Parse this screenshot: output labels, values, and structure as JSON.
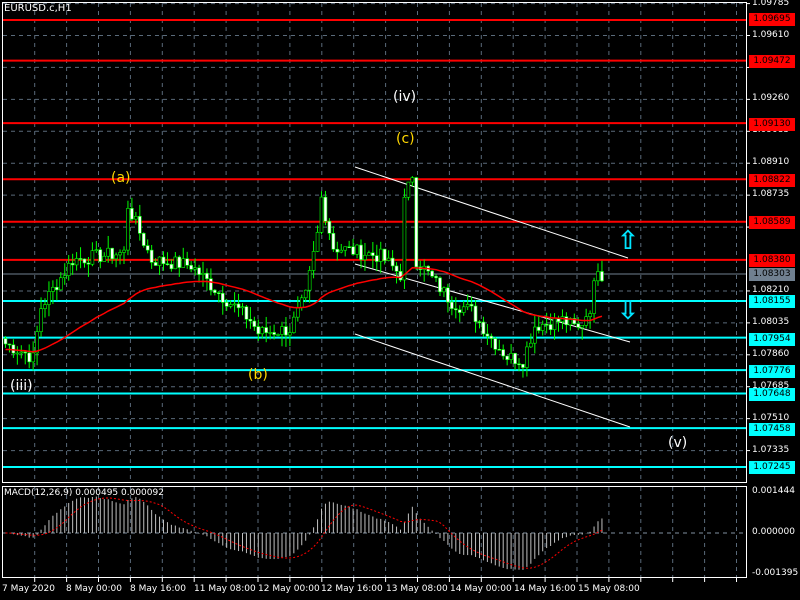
{
  "header": {
    "symbol_title": "EURUSD.c,H1"
  },
  "colors": {
    "resistance": "#ff0000",
    "support": "#00ffff",
    "bull": "#00ff00",
    "current": "#708090",
    "grid": "#6b7b8c",
    "ma": "#ff0000"
  },
  "price_axis": {
    "ticks": [
      "1.09785",
      "1.09610",
      "1.09435",
      "1.09260",
      "1.09085",
      "1.08910",
      "1.08735",
      "1.08560",
      "1.08210",
      "1.08035",
      "1.07860",
      "1.07685",
      "1.07510",
      "1.07335"
    ],
    "tick_values": [
      1.09785,
      1.0961,
      1.09435,
      1.0926,
      1.09085,
      1.0891,
      1.08735,
      1.0856,
      1.0821,
      1.08035,
      1.0786,
      1.07685,
      1.0751,
      1.07335
    ]
  },
  "levels": {
    "resistance": [
      "1.09695",
      "1.09472",
      "1.09130",
      "1.08822",
      "1.08589",
      "1.08380"
    ],
    "support": [
      "1.08155",
      "1.07954",
      "1.07776",
      "1.07648",
      "1.07458",
      "1.07245"
    ],
    "current": "1.08303"
  },
  "wave_labels": [
    {
      "text": "(iii)",
      "color": "#ffffff"
    },
    {
      "text": "(a)",
      "color": "#ffd700"
    },
    {
      "text": "(b)",
      "color": "#ffd700"
    },
    {
      "text": "(iv)",
      "color": "#ffffff"
    },
    {
      "text": "(c)",
      "color": "#ffd700"
    },
    {
      "text": "(v)",
      "color": "#ffffff"
    }
  ],
  "signals": {
    "up_arrow": "⇧",
    "down_arrow": "⇩"
  },
  "macd": {
    "title": "MACD(12,26,9) 0.000495 0.000092",
    "axis": [
      "0.001444",
      "0.000000",
      "-0.001395"
    ]
  },
  "time_axis": [
    "7 May 2020",
    "8 May 00:00",
    "8 May 16:00",
    "11 May 08:00",
    "12 May 00:00",
    "12 May 16:00",
    "13 May 08:00",
    "14 May 00:00",
    "14 May 16:00",
    "15 May 08:00"
  ],
  "chart_data": {
    "type": "candlestick",
    "symbol": "EURUSD.c",
    "timeframe": "H1",
    "ylim": [
      1.072,
      1.098
    ],
    "price_waypoints": [
      [
        0,
        1.0792
      ],
      [
        5,
        1.0787
      ],
      [
        7,
        1.0784
      ],
      [
        9,
        1.0812
      ],
      [
        17,
        1.0838
      ],
      [
        30,
        1.0842
      ],
      [
        31,
        1.0868
      ],
      [
        37,
        1.0838
      ],
      [
        47,
        1.0835
      ],
      [
        55,
        1.0818
      ],
      [
        62,
        1.0805
      ],
      [
        64,
        1.0798
      ],
      [
        72,
        1.08
      ],
      [
        76,
        1.0818
      ],
      [
        79,
        1.0852
      ],
      [
        80,
        1.0872
      ],
      [
        83,
        1.0845
      ],
      [
        95,
        1.084
      ],
      [
        100,
        1.083
      ],
      [
        101,
        1.087
      ],
      [
        103,
        1.0885
      ],
      [
        104,
        1.0838
      ],
      [
        113,
        1.0815
      ],
      [
        118,
        1.081
      ],
      [
        123,
        1.0795
      ],
      [
        127,
        1.0785
      ],
      [
        131,
        1.0783
      ],
      [
        134,
        1.0802
      ],
      [
        141,
        1.0805
      ],
      [
        145,
        1.08
      ],
      [
        148,
        1.0812
      ],
      [
        150,
        1.0835
      ],
      [
        151,
        1.083
      ]
    ],
    "moving_average": "red",
    "macd_params": [
      12,
      26,
      9
    ]
  }
}
